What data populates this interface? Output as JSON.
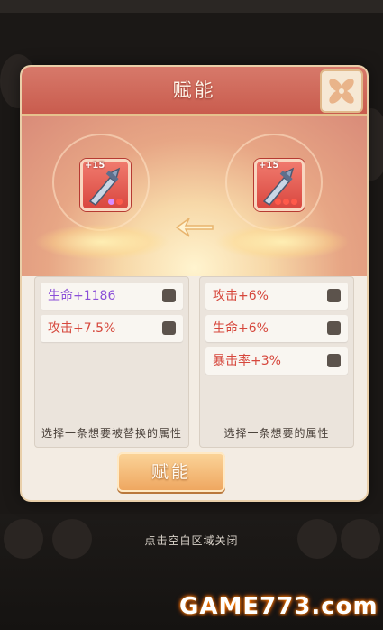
{
  "modal": {
    "title": "赋能",
    "close_icon": "flower-close-icon"
  },
  "items": {
    "left": {
      "level": "+15",
      "icon": "sword-icon",
      "slot_colors": [
        "#d98cff",
        "#ff5a4a"
      ]
    },
    "right": {
      "level": "+15",
      "icon": "sword-icon",
      "slot_colors": [
        "#ff5a4a",
        "#ff5a4a",
        "#ff5a4a"
      ]
    },
    "transfer_icon": "left-arrow-icon"
  },
  "left_panel": {
    "rows": [
      {
        "label": "生命+1186",
        "color": "#8b4fd8"
      },
      {
        "label": "攻击+7.5%",
        "color": "#d6473c"
      }
    ],
    "footer": "选择一条想要被替换的属性"
  },
  "right_panel": {
    "rows": [
      {
        "label": "攻击+6%",
        "color": "#d6473c"
      },
      {
        "label": "生命+6%",
        "color": "#d6473c"
      },
      {
        "label": "暴击率+3%",
        "color": "#d6473c"
      }
    ],
    "footer": "选择一条想要的属性"
  },
  "confirm_button": "赋能",
  "close_hint": "点击空白区域关闭",
  "watermark": "GAME773.com"
}
